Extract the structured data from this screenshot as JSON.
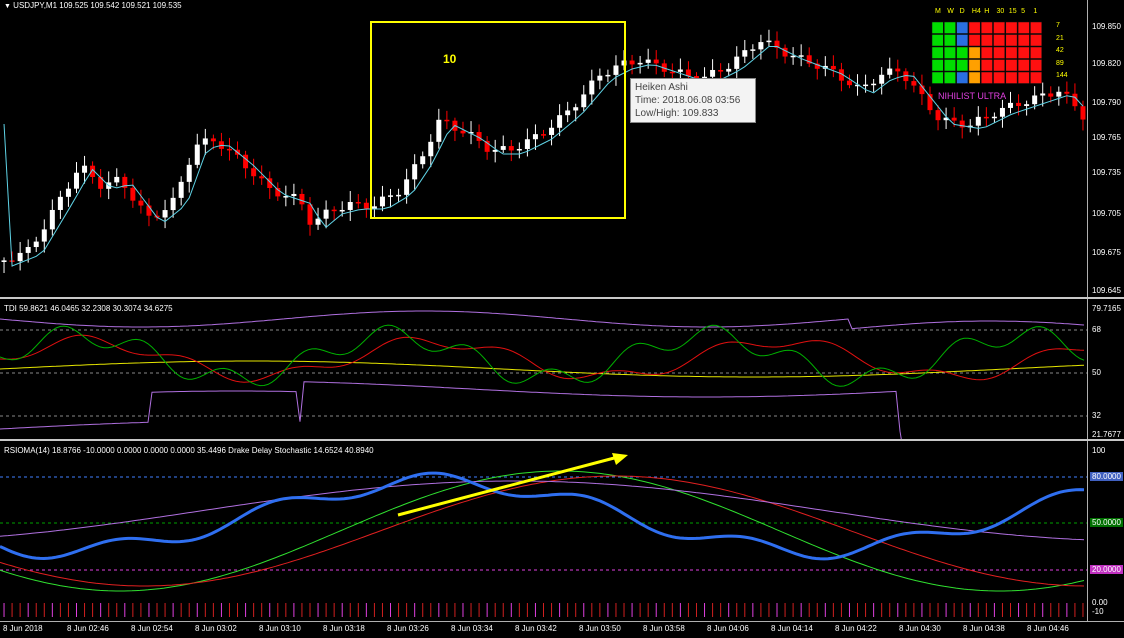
{
  "main": {
    "header": "USDJPY,M1  109.525 109.542 109.521 109.535",
    "box_label": "10",
    "price_axis": [
      "109.850",
      "109.820",
      "109.790",
      "109.765",
      "109.735",
      "109.705",
      "109.675",
      "109.645"
    ],
    "tooltip": {
      "title": "Heiken Ashi",
      "time": "Time: 2018.06.08 03:56",
      "lowhigh": "Low/High: 109.833"
    },
    "matrix": {
      "timeframes": [
        "M",
        "W",
        "D",
        "H4",
        "H",
        "30",
        "15",
        "5",
        "1"
      ],
      "periods": [
        "7",
        "21",
        "42",
        "89",
        "144"
      ],
      "label": "NIHILIST ULTRA"
    }
  },
  "tdi": {
    "header": "TDI 59.8621 46.0465 32.2308 30.3074 34.6275",
    "axis": [
      "79.7165",
      "68",
      "50",
      "32",
      "21.7677"
    ]
  },
  "rsioma": {
    "header": "RSIOMA(14) 18.8766 -10.0000 0.0000 0.0000 0.0000 35.4496  Drake Delay Stochastic 14.6524 40.8940",
    "axis": [
      "100",
      "80.0000",
      "50.0000",
      "20.0000",
      "0.00",
      "-10"
    ]
  },
  "time_axis": [
    "8 Jun 2018",
    "8 Jun 02:46",
    "8 Jun 02:54",
    "8 Jun 03:02",
    "8 Jun 03:10",
    "8 Jun 03:18",
    "8 Jun 03:26",
    "8 Jun 03:34",
    "8 Jun 03:42",
    "8 Jun 03:50",
    "8 Jun 03:58",
    "8 Jun 04:06",
    "8 Jun 04:14",
    "8 Jun 04:22",
    "8 Jun 04:30",
    "8 Jun 04:38",
    "8 Jun 04:46"
  ],
  "colors": {
    "bull": "#ffffff",
    "bear": "#ff0000",
    "ma": "#5fd3e6",
    "box": "#ffff00",
    "tdi_green": "#00b000",
    "tdi_red": "#e01010",
    "tdi_yellow": "#e6e600",
    "tdi_band": "#b070e0",
    "rsioma_blue": "#2f6ff0",
    "stoch_green": "#30e030",
    "stoch_red": "#e02020",
    "stoch_violet": "#b070e0",
    "level80": "#4080ff",
    "level50": "#00a000",
    "level20": "#e040e0"
  }
}
